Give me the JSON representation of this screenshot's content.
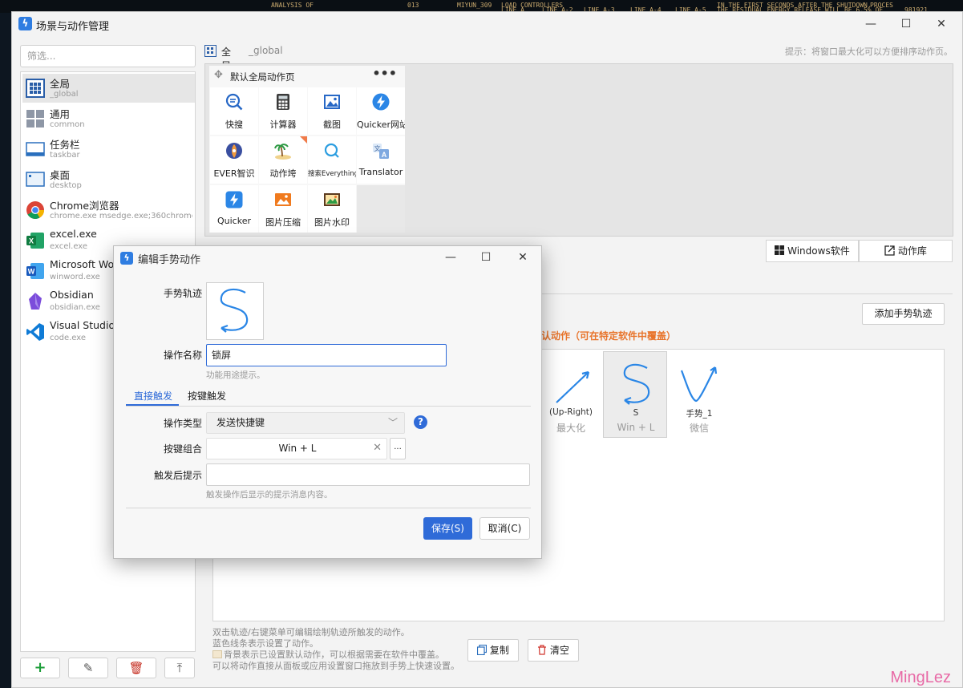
{
  "desktop_text": [
    "ANALYSIS OF",
    "013",
    "MIYUN_309",
    "LOAD CONTROLLERS",
    "LINE A",
    "LINE A-2",
    "LINE A-3",
    "LINE A-4",
    "LINE A-5",
    "IN THE FIRST SECONDS AFTER THE SHUTDOWN,",
    "THE RESIDUAL ENERGY RELEASE WILL BE 6.5% OF",
    "PROCES",
    "981921"
  ],
  "window": {
    "title": "场景与动作管理",
    "minimize": "—",
    "maximize": "☐",
    "close": "✕"
  },
  "left": {
    "filter_placeholder": "筛选...",
    "scenes": [
      {
        "name": "全局",
        "sub": "_global",
        "icon": "grid-icon",
        "selected": true
      },
      {
        "name": "通用",
        "sub": "common",
        "icon": "tiles-icon"
      },
      {
        "name": "任务栏",
        "sub": "taskbar",
        "icon": "taskbar-icon"
      },
      {
        "name": "桌面",
        "sub": "desktop",
        "icon": "desktop-icon"
      },
      {
        "name": "Chrome浏览器",
        "sub": "chrome.exe  msedge.exe;360chrome.exe",
        "icon": "chrome-icon"
      },
      {
        "name": "excel.exe",
        "sub": "excel.exe",
        "icon": "excel-icon"
      },
      {
        "name": "Microsoft Word",
        "sub": "winword.exe",
        "icon": "word-icon"
      },
      {
        "name": "Obsidian",
        "sub": "obsidian.exe",
        "icon": "obsidian-icon"
      },
      {
        "name": "Visual Studio Code",
        "sub": "code.exe",
        "icon": "vscode-icon"
      }
    ],
    "tools": {
      "add": "+",
      "edit": "✎",
      "delete": "🗑",
      "top": "⤒"
    }
  },
  "crumb": {
    "name": "全局",
    "id": "_global"
  },
  "hint": "提示：将窗口最大化可以方便排序动作页。",
  "action_page": {
    "title": "默认全局动作页",
    "more": "•••",
    "items": [
      {
        "label": "快搜",
        "icon": "search-icon"
      },
      {
        "label": "计算器",
        "icon": "calculator-icon"
      },
      {
        "label": "截图",
        "icon": "screenshot-icon"
      },
      {
        "label": "Quicker网站",
        "icon": "quicker-icon"
      },
      {
        "label": "EVER智识",
        "icon": "ever-icon"
      },
      {
        "label": "动作垮",
        "icon": "island-icon"
      },
      {
        "label": "搜索Everything",
        "icon": "everything-icon"
      },
      {
        "label": "Translator",
        "icon": "translator-icon"
      },
      {
        "label": "Quicker",
        "icon": "quicker-icon"
      },
      {
        "label": "图片压缩",
        "icon": "image-compress-icon"
      },
      {
        "label": "图片水印",
        "icon": "image-watermark-icon"
      }
    ]
  },
  "buttons": {
    "windows_software": "Windows软件",
    "action_library": "动作库",
    "add_gesture": "添加手势轨迹",
    "copy": "复制",
    "clear": "清空"
  },
  "default_title": "认动作（可在特定软件中覆盖）",
  "gestures": [
    {
      "name": "(Up-Right)",
      "sub": "最大化"
    },
    {
      "name": "S",
      "sub": "Win + L",
      "selected": true
    },
    {
      "name": "手势_1",
      "sub": "微信"
    }
  ],
  "notes": [
    "双击轨迹/右键菜单可编辑绘制轨迹所触发的动作。",
    "蓝色线条表示设置了动作。",
    "背景表示已设置默认动作，可以根据需要在软件中覆盖。",
    "可以将动作直接从面板或应用设置窗口拖放到手势上快速设置。"
  ],
  "dialog": {
    "title": "编辑手势动作",
    "min": "—",
    "max": "☐",
    "close": "✕",
    "gesture_label": "手势轨迹",
    "name_label": "操作名称",
    "name_value": "锁屏",
    "name_hint": "功能用途提示。",
    "tabs": [
      "直接触发",
      "按键触发"
    ],
    "type_label": "操作类型",
    "type_value": "发送快捷键",
    "keys_label": "按键组合",
    "keys_value": "Win + L",
    "keys_clear": "✕",
    "keys_more": "...",
    "tip_label": "触发后提示",
    "tip_hint": "触发操作后显示的提示消息内容。",
    "save": "保存(S)",
    "cancel": "取消(C)",
    "help": "?"
  },
  "watermark": "MingLez"
}
